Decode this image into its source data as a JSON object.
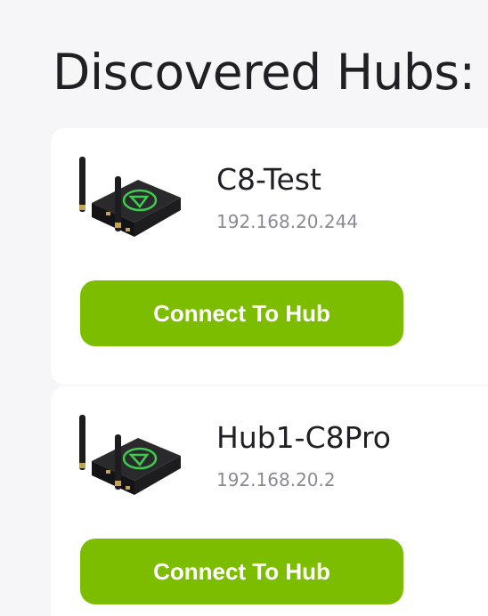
{
  "page": {
    "title": "Discovered Hubs:"
  },
  "hubs": [
    {
      "name": "C8-Test",
      "ip": "192.168.20.244",
      "button_label": "Connect To Hub"
    },
    {
      "name": "Hub1-C8Pro",
      "ip": "192.168.20.2",
      "button_label": "Connect To Hub"
    }
  ],
  "colors": {
    "background": "#f6f6f9",
    "card": "#ffffff",
    "button": "#7dbd00",
    "button_text": "#ffffff",
    "title_text": "#1f1f24",
    "ip_text": "#8a8a94",
    "device_body": "#1d1d1f",
    "device_logo": "#3dcc4e"
  },
  "icons": {
    "hub_device": "hubitat-hub-device-icon"
  }
}
